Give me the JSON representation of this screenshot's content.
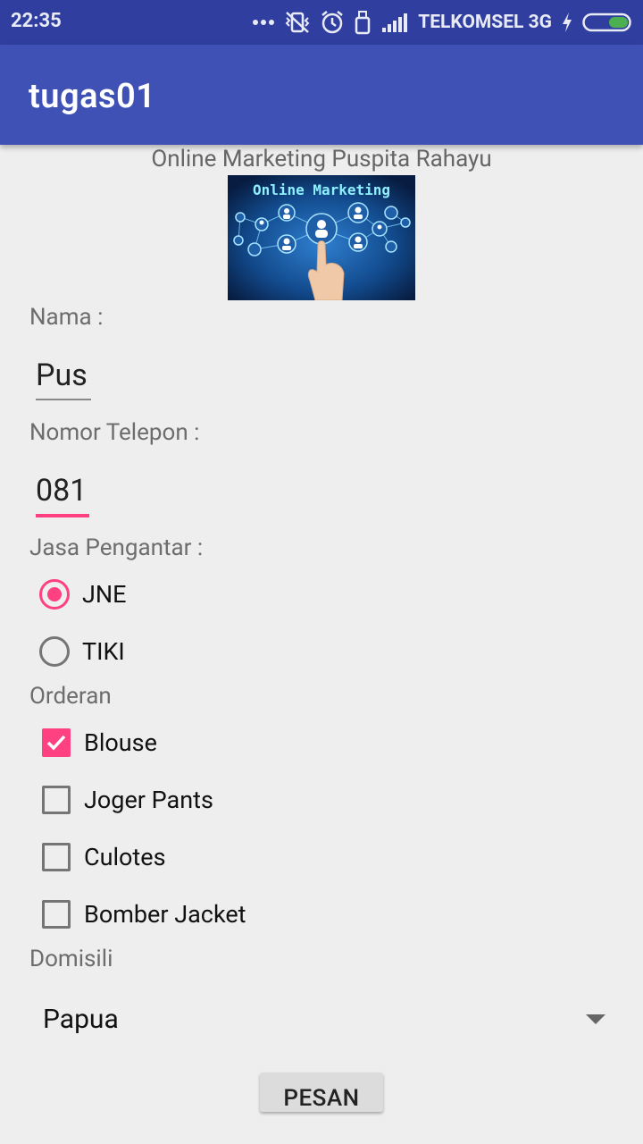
{
  "status_bar": {
    "time": "22:35",
    "carrier": "TELKOMSEL 3G",
    "icons": [
      "more-dots-icon",
      "vibrate-off-icon",
      "alarm-icon",
      "usb-icon",
      "signal-icon",
      "charging-icon",
      "battery-icon"
    ]
  },
  "app_bar": {
    "title": "tugas01"
  },
  "header": {
    "title": "Online Marketing Puspita Rahayu",
    "banner_text": "Online Marketing"
  },
  "form": {
    "nama_label": "Nama :",
    "nama_value": "Pus",
    "telepon_label": "Nomor Telepon :",
    "telepon_value": "081",
    "jasa_label": "Jasa Pengantar :",
    "jasa_options": [
      {
        "label": "JNE",
        "selected": true
      },
      {
        "label": "TIKI",
        "selected": false
      }
    ],
    "orderan_label": "Orderan",
    "orderan_options": [
      {
        "label": "Blouse",
        "checked": true
      },
      {
        "label": "Joger Pants",
        "checked": false
      },
      {
        "label": "Culotes",
        "checked": false
      },
      {
        "label": "Bomber Jacket",
        "checked": false
      }
    ],
    "domisili_label": "Domisili",
    "domisili_value": "Papua",
    "submit_label": "PESAN"
  },
  "colors": {
    "primary": "#3f51b5",
    "primary_dark": "#303f9f",
    "accent": "#ff4081",
    "background": "#eeeeee"
  }
}
